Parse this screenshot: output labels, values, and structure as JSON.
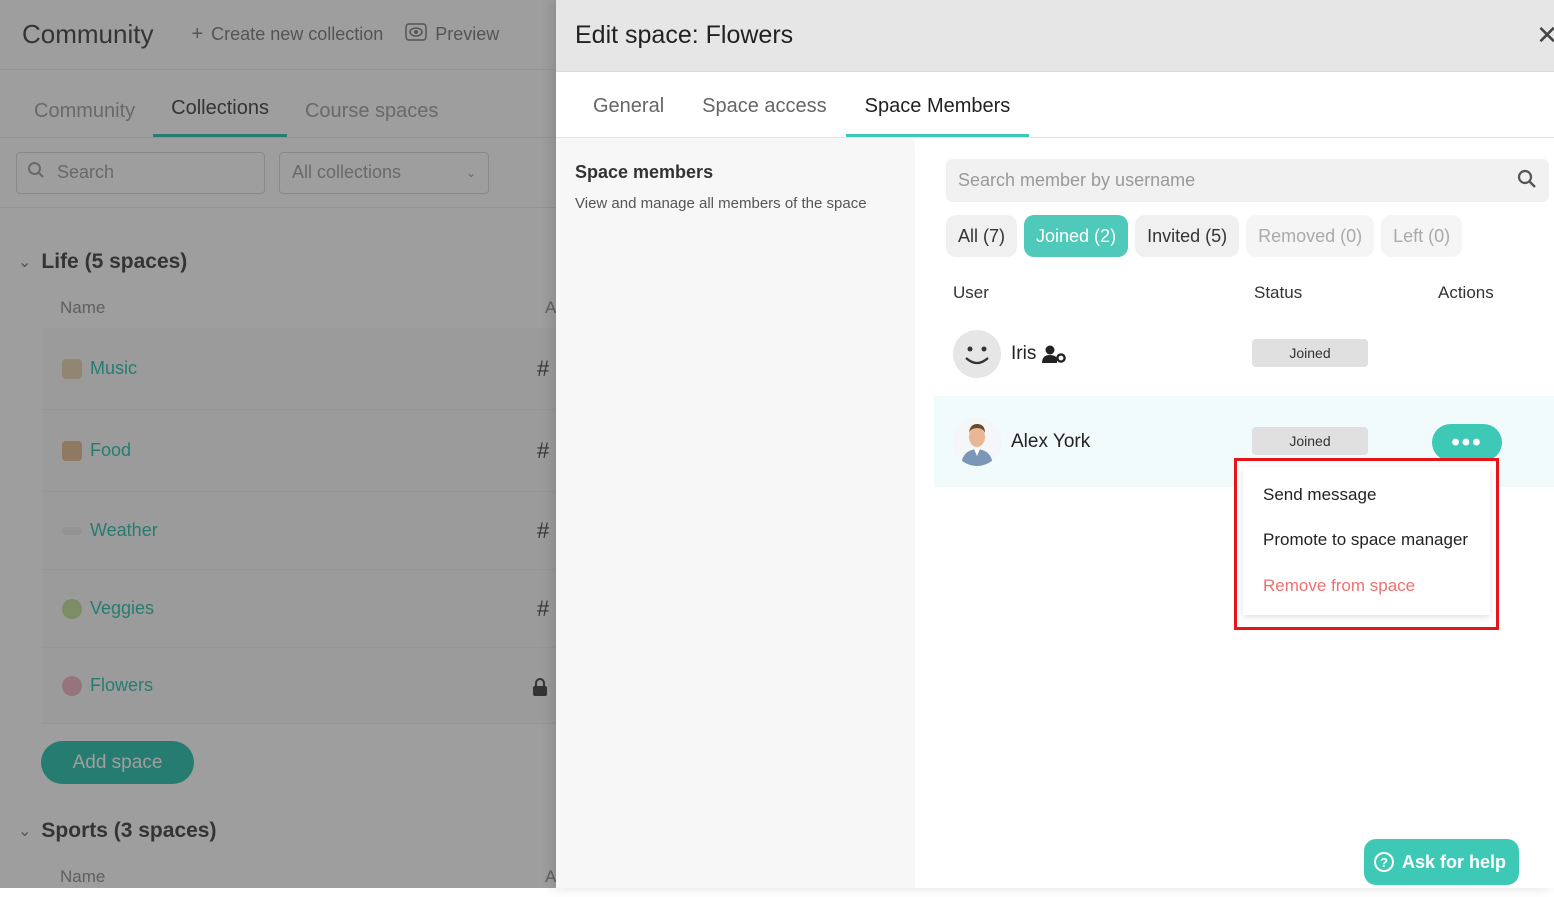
{
  "background": {
    "app_title": "Community",
    "top_actions": [
      {
        "icon": "plus-icon",
        "label": "Create new collection"
      },
      {
        "icon": "eye-icon",
        "label": "Preview"
      }
    ],
    "tabs": [
      {
        "label": "Community",
        "active": false
      },
      {
        "label": "Collections",
        "active": true
      },
      {
        "label": "Course spaces",
        "active": false
      }
    ],
    "search_placeholder": "Search",
    "collection_filter": "All collections",
    "groups": [
      {
        "title": "Life (5 spaces)",
        "column_name": "Name",
        "column_access": "A",
        "spaces": [
          {
            "name": "Music",
            "access": "#"
          },
          {
            "name": "Food",
            "access": "#"
          },
          {
            "name": "Weather",
            "access": "#"
          },
          {
            "name": "Veggies",
            "access": "#"
          },
          {
            "name": "Flowers",
            "access": "lock-icon"
          }
        ],
        "add_button": "Add space"
      },
      {
        "title": "Sports (3 spaces)",
        "column_name": "Name",
        "column_access": "A"
      }
    ]
  },
  "drawer": {
    "title": "Edit space: Flowers",
    "close_icon": "close-icon",
    "tabs": [
      {
        "label": "General",
        "active": false
      },
      {
        "label": "Space access",
        "active": false
      },
      {
        "label": "Space Members",
        "active": true
      }
    ],
    "section": {
      "heading": "Space members",
      "description": "View and manage all members of the space"
    },
    "member_search_placeholder": "Search member by username",
    "filters": [
      {
        "label": "All (7)",
        "state": "normal"
      },
      {
        "label": "Joined (2)",
        "state": "active"
      },
      {
        "label": "Invited (5)",
        "state": "normal"
      },
      {
        "label": "Removed (0)",
        "state": "disabled"
      },
      {
        "label": "Left (0)",
        "state": "disabled"
      }
    ],
    "columns": {
      "user": "User",
      "status": "Status",
      "actions": "Actions"
    },
    "members": [
      {
        "name": "Iris",
        "badge_icon": "user-gear-icon",
        "status": "Joined"
      },
      {
        "name": "Alex York",
        "status": "Joined",
        "actions_label": "•••"
      }
    ],
    "action_menu": [
      {
        "label": "Send message",
        "danger": false
      },
      {
        "label": "Promote to space manager",
        "danger": false
      },
      {
        "label": "Remove from space",
        "danger": true
      }
    ]
  },
  "help_button": "Ask for help",
  "colors": {
    "accent": "#3ec9b7",
    "danger": "#f0706e",
    "highlight_box": "#e8141c"
  }
}
